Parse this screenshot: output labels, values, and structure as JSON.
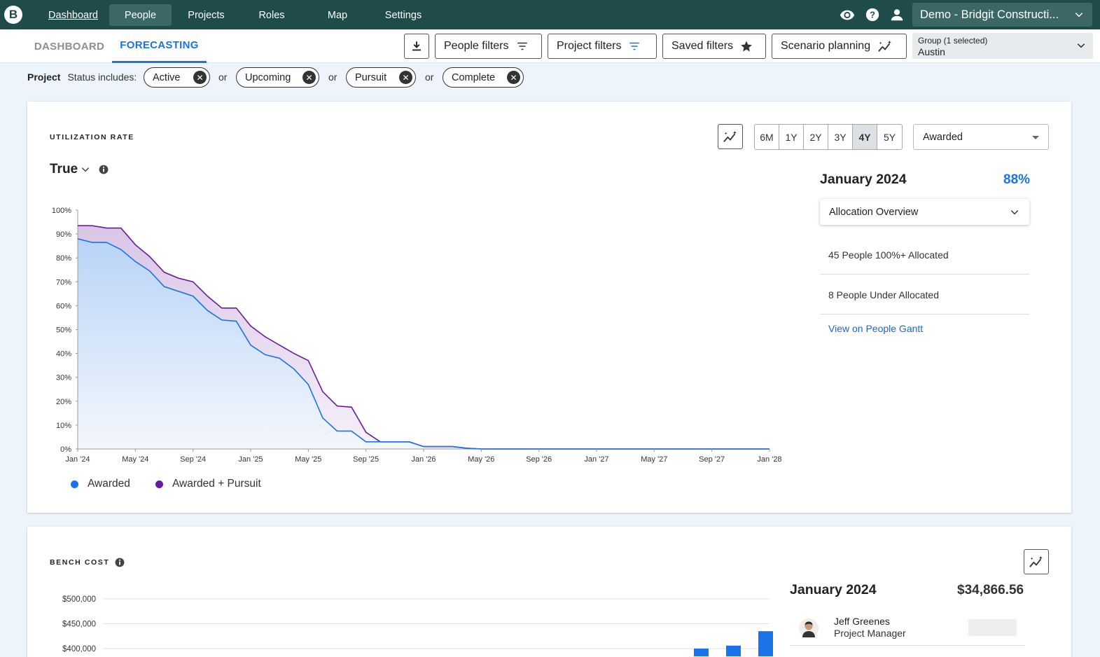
{
  "nav": {
    "logo": "B",
    "items": [
      "Dashboard",
      "People",
      "Projects",
      "Roles",
      "Map",
      "Settings"
    ],
    "account": "Demo - Bridgit Constructi..."
  },
  "subbar": {
    "tabs": [
      "DASHBOARD",
      "FORECASTING"
    ],
    "people_filters": "People filters",
    "project_filters": "Project filters",
    "saved_filters": "Saved filters",
    "scenario_planning": "Scenario planning",
    "group_label": "Group (1 selected)",
    "group_value": "Austin"
  },
  "filters": {
    "label": "Project",
    "status_label": "Status includes:",
    "chips": [
      "Active",
      "Upcoming",
      "Pursuit",
      "Complete"
    ],
    "separator": "or"
  },
  "utilization": {
    "title": "UTILIZATION RATE",
    "selector": "True",
    "ranges": [
      "6M",
      "1Y",
      "2Y",
      "3Y",
      "4Y",
      "5Y"
    ],
    "selected_range": "4Y",
    "dropdown": "Awarded",
    "period": "January 2024",
    "rate": "88%",
    "allocation_dropdown": "Allocation Overview",
    "stats": [
      "45 People 100%+ Allocated",
      "8 People Under Allocated"
    ],
    "link": "View on People Gantt",
    "legend": [
      "Awarded",
      "Awarded + Pursuit"
    ],
    "colors": {
      "awarded": "#1a73e8",
      "pursuit": "#6a1b9a"
    }
  },
  "chart_data": [
    {
      "type": "area",
      "x": [
        "Jan '24",
        "Feb '24",
        "Mar '24",
        "Apr '24",
        "May '24",
        "Jun '24",
        "Jul '24",
        "Aug '24",
        "Sep '24",
        "Oct '24",
        "Nov '24",
        "Dec '24",
        "Jan '25",
        "Feb '25",
        "Mar '25",
        "Apr '25",
        "May '25",
        "Jun '25",
        "Jul '25",
        "Aug '25",
        "Sep '25",
        "Oct '25",
        "Nov '25",
        "Dec '25",
        "Jan '26",
        "Feb '26",
        "Mar '26",
        "Apr '26",
        "May '26",
        "Jun '26",
        "Jul '26",
        "Aug '26",
        "Sep '26",
        "Oct '26",
        "Nov '26",
        "Dec '26",
        "Jan '27",
        "Feb '27",
        "Mar '27",
        "Apr '27",
        "May '27",
        "Jun '27",
        "Jul '27",
        "Aug '27",
        "Sep '27",
        "Oct '27",
        "Nov '27",
        "Dec '27",
        "Jan '28"
      ],
      "series": [
        {
          "name": "Awarded",
          "values": [
            88,
            86.5,
            86.5,
            83.5,
            78.5,
            74.5,
            68,
            66,
            64,
            58,
            54,
            53.5,
            43.5,
            39.5,
            38,
            33.5,
            27,
            13,
            7.5,
            7.5,
            3,
            3,
            3,
            3,
            1,
            1,
            1,
            0.3,
            0,
            0,
            0,
            0,
            0,
            0,
            0,
            0,
            0,
            0,
            0,
            0,
            0,
            0,
            0,
            0,
            0,
            0,
            0,
            0,
            0
          ]
        },
        {
          "name": "Awarded + Pursuit",
          "values": [
            93.5,
            93.5,
            92.5,
            92.5,
            85.5,
            80.5,
            74,
            71.5,
            70,
            64,
            59,
            59,
            51.5,
            47,
            43.5,
            40,
            37,
            24,
            18,
            17.5,
            7,
            3,
            3,
            3,
            1,
            1,
            1,
            0.3,
            0,
            0,
            0,
            0,
            0,
            0,
            0,
            0,
            0,
            0,
            0,
            0,
            0,
            0,
            0,
            0,
            0,
            0,
            0,
            0,
            0
          ]
        }
      ],
      "x_tick_labels": [
        "Jan '24",
        "May '24",
        "Sep '24",
        "Jan '25",
        "May '25",
        "Sep '25",
        "Jan '26",
        "May '26",
        "Sep '26",
        "Jan '27",
        "May '27",
        "Sep '27",
        "Jan '28"
      ],
      "y_tick_labels": [
        "0%",
        "10%",
        "20%",
        "30%",
        "40%",
        "50%",
        "60%",
        "70%",
        "80%",
        "90%",
        "100%"
      ],
      "ylim": [
        0,
        100
      ],
      "legend": "bottom-left"
    },
    {
      "type": "bar",
      "y_tick_labels": [
        "$500,000",
        "$450,000",
        "$400,000"
      ],
      "visible_bar_values": [
        400000,
        406000,
        435000
      ]
    }
  ],
  "bench": {
    "title": "BENCH COST",
    "period": "January 2024",
    "total": "$34,866.56",
    "person_name": "Jeff Greenes",
    "person_role": "Project Manager"
  }
}
